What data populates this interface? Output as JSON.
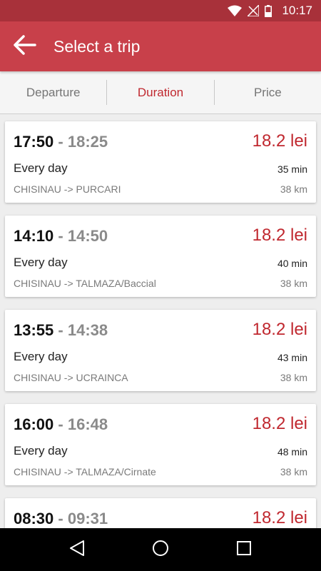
{
  "status": {
    "time": "10:17"
  },
  "app_bar": {
    "title": "Select a trip"
  },
  "sort_tabs": [
    {
      "label": "Departure"
    },
    {
      "label": "Duration"
    },
    {
      "label": "Price"
    }
  ],
  "trips": [
    {
      "dep": "17:50",
      "arr": "18:25",
      "price": "18.2 lei",
      "freq": "Every day",
      "duration": "35 min",
      "route": "CHISINAU -> PURCARI",
      "distance": "38 km"
    },
    {
      "dep": "14:10",
      "arr": "14:50",
      "price": "18.2 lei",
      "freq": "Every day",
      "duration": "40 min",
      "route": "CHISINAU -> TALMAZA/Baccial",
      "distance": "38 km"
    },
    {
      "dep": "13:55",
      "arr": "14:38",
      "price": "18.2 lei",
      "freq": "Every day",
      "duration": "43 min",
      "route": "CHISINAU -> UCRAINCA",
      "distance": "38 km"
    },
    {
      "dep": "16:00",
      "arr": "16:48",
      "price": "18.2 lei",
      "freq": "Every day",
      "duration": "48 min",
      "route": "CHISINAU -> TALMAZA/Cirnate",
      "distance": "38 km"
    },
    {
      "dep": "08:30",
      "arr": "09:31",
      "price": "18.2 lei",
      "freq": "",
      "duration": "",
      "route": "",
      "distance": ""
    }
  ],
  "colors": {
    "primary": "#c8404a",
    "primary_dark": "#a8313a",
    "accent": "#c0282f"
  },
  "icons": {
    "back": "arrow-back-icon",
    "wifi": "wifi-icon",
    "signal": "no-signal-icon",
    "battery": "battery-icon"
  }
}
